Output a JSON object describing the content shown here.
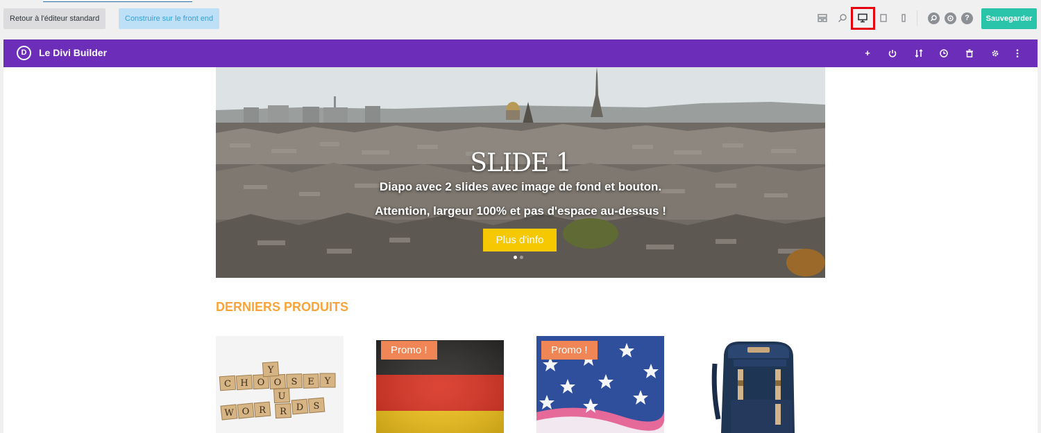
{
  "toolbar": {
    "back_label": "Retour à l'éditeur standard",
    "frontend_label": "Construire sur le front end",
    "save_label": "Sauvegarder",
    "help_label": "?"
  },
  "builder": {
    "logo_letter": "D",
    "title": "Le Divi Builder",
    "icons": [
      "plus-icon",
      "power-icon",
      "sort-icon",
      "history-icon",
      "trash-icon",
      "gear-icon",
      "more-icon"
    ]
  },
  "slider": {
    "title": "SLIDE 1",
    "line1": "Diapo avec 2 slides avec image de fond et bouton.",
    "line2": "Attention, largeur 100% et pas d'espace au-dessus !",
    "button_label": "Plus d'info"
  },
  "section": {
    "title": "DERNIERS PRODUITS"
  },
  "products": [
    {
      "image": "scrabble-tiles",
      "promo": ""
    },
    {
      "image": "german-flag",
      "promo": "Promo !"
    },
    {
      "image": "us-flag",
      "promo": "Promo !"
    },
    {
      "image": "backpack",
      "promo": ""
    }
  ],
  "colors": {
    "divi_purple": "#6c2eb9",
    "save_green": "#29c4a9",
    "section_orange": "#f9a43a",
    "promo_orange": "#f08556",
    "slide_button_yellow": "#f5c800",
    "highlight_red": "#e4000f"
  }
}
